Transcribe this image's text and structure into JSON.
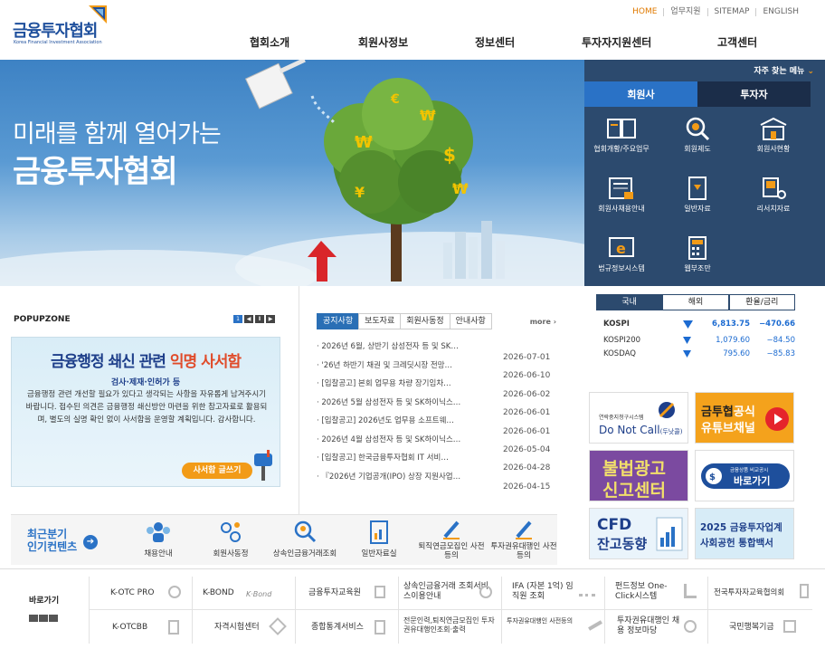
{
  "header": {
    "logo_text": "금융투자협회",
    "logo_sub": "Korea Financial Investment Association",
    "util": [
      "HOME",
      "업무지원",
      "SITEMAP",
      "ENGLISH"
    ],
    "nav": [
      "협회소개",
      "회원사정보",
      "정보센터",
      "투자자지원센터",
      "고객센터"
    ]
  },
  "hero": {
    "line1": "미래를 함께 열어가는",
    "line2": "금융투자협회"
  },
  "quick_menu": {
    "title": "자주 찾는 메뉴",
    "tabs": [
      "회원사",
      "투자자"
    ],
    "items": [
      "협회개황/주요업무",
      "회원제도",
      "회원사현황",
      "회원사채용안내",
      "일반자료",
      "리서치자료",
      "법규정보시스템",
      "웹부조만"
    ]
  },
  "popupzone": {
    "title": "POPUPZONE",
    "controls": [
      "1",
      "◀",
      "Ⅱ",
      "▶"
    ],
    "headline_pre": "금융행정 쇄신 관련 ",
    "headline_em": "익명 사서함",
    "subhead": "검사·제재·인허가 등",
    "body": "금융행정 관련 개선할 필요가 있다고 생각되는 사항을 자유롭게 남겨주시기 바랍니다. 접수된 의견은 금융행정 쇄신방안 마련을 위한 참고자료로 활용되며, 별도의 실명 확인 없이 사서함을 운영할 계획입니다. 감사합니다.",
    "button": "사서함 글쓰기"
  },
  "notice": {
    "tabs": [
      "공지사항",
      "보도자료",
      "회원사동정",
      "안내사항"
    ],
    "more": "more",
    "items": [
      "· 2026년 6월, 상반기 삼성전자 등 및 SK…",
      "· '26년 하반기 채권 및 크레딧시장 전망…",
      "· [입찰공고] 본회 업무용 차량 장기임차…",
      "· 2026년 5월 삼성전자 등 및 SK하이닉스…",
      "· [입찰공고] 2026년도 업무용 소프트웨…",
      "· 2026년 4월 삼성전자 등 및 SK하이닉스…",
      "· [입찰공고] 한국금융투자협회 IT 서비…",
      "· 『2026년 기업공개(IPO) 상장 지원사업…"
    ],
    "dates": [
      "2026-07-01",
      "2026-06-10",
      "2026-06-02",
      "2026-06-01",
      "2026-06-01",
      "2026-05-04",
      "2026-04-28",
      "2026-04-15"
    ]
  },
  "market": {
    "tabs": [
      "국내",
      "해외",
      "환율/금리"
    ],
    "rows": [
      {
        "name": "KOSPI",
        "value": "6,813.75",
        "change": "−470.66"
      },
      {
        "name": "KOSPI200",
        "value": "1,079.60",
        "change": "−84.50"
      },
      {
        "name": "KOSDAQ",
        "value": "795.60",
        "change": "−85.83"
      }
    ]
  },
  "banners": {
    "b1_small": "연락중지청구시스템",
    "b1_main": "Do Not Call",
    "b1_paren": "(두낫콜)",
    "b2_line1a": "금투협",
    "b2_line1b": "공식",
    "b2_line2": "유튜브채널",
    "b3_line1": "불법광고",
    "b3_line2": "신고센터",
    "b4_small": "금융상품 비교공시",
    "b4_main": "바로가기",
    "b5_line1": "CFD",
    "b5_line2": "잔고동향",
    "b6_line1": "2025 금융투자업계",
    "b6_line2": "사회공헌 통합백서"
  },
  "quick_contents": {
    "label1": "최근분기",
    "label2": "인기컨텐츠",
    "arrow": "➔",
    "items": [
      "채용안내",
      "회원사동정",
      "상속인금융거래조회",
      "일반자료실",
      "퇴직연금모집인 사전등의",
      "투자권유대행인 사전등의"
    ]
  },
  "bottom_links": {
    "title": "바로가기",
    "row1": [
      "K-OTC PRO",
      "K-BOND",
      "금융투자교육원",
      "상속인금융거래 조회서비스이용안내",
      "IFA (자본 1억) 임직원 조회",
      "펀드정보 One-Click시스템",
      "전국투자자교육협의회"
    ],
    "row2": [
      "K-OTCBB",
      "자격시험센터",
      "종합통계서비스",
      "전문인력,퇴직연금모집인 투자권유대행인조회·출력",
      "투자권유대행인 사전등의",
      "투자권유대행인 채용 정보마당",
      "국민행복기금"
    ],
    "kbond_logo": "K·Bond"
  }
}
